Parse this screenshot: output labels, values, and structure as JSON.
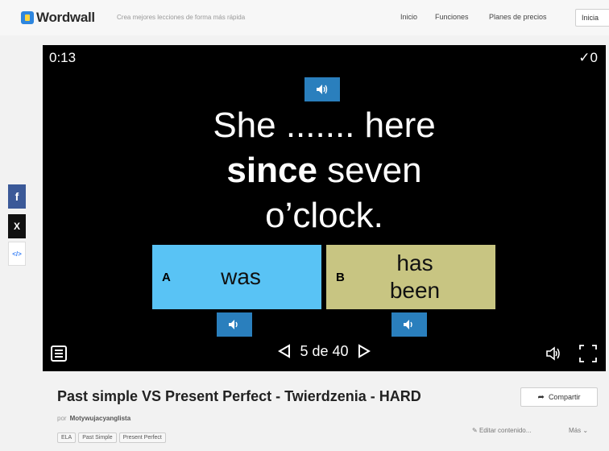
{
  "header": {
    "brand": "Wordwall",
    "tagline": "Crea mejores lecciones de forma más rápida",
    "nav": [
      "Inicio",
      "Funciones",
      "Planes de precios"
    ],
    "start_button": "Inicia"
  },
  "share": {
    "facebook_glyph": "f",
    "x_glyph": "X",
    "embed_glyph": "</>"
  },
  "game": {
    "timer": "0:13",
    "score": "✓0",
    "question_line1": "She ....... here",
    "question_bold": "since",
    "question_line2_rest": " seven",
    "question_line3": "o’clock.",
    "answers": [
      {
        "letter": "A",
        "text": "was",
        "color": "#59c3f5"
      },
      {
        "letter": "B",
        "text": "has been",
        "color": "#c8c582"
      }
    ],
    "pager": "5 de 40",
    "icons": [
      "speaker-icon",
      "menu-icon",
      "sound-icon",
      "fullscreen-icon"
    ]
  },
  "activity": {
    "title": "Past simple VS Present Perfect - Twierdzenia - HARD",
    "share_button": "Compartir",
    "by_label": "por",
    "author": "Motywujacyanglista",
    "tags": [
      "ELA",
      "Past Simple",
      "Present Perfect"
    ],
    "edit_link": "Editar contenido...",
    "more_link": "Más"
  }
}
